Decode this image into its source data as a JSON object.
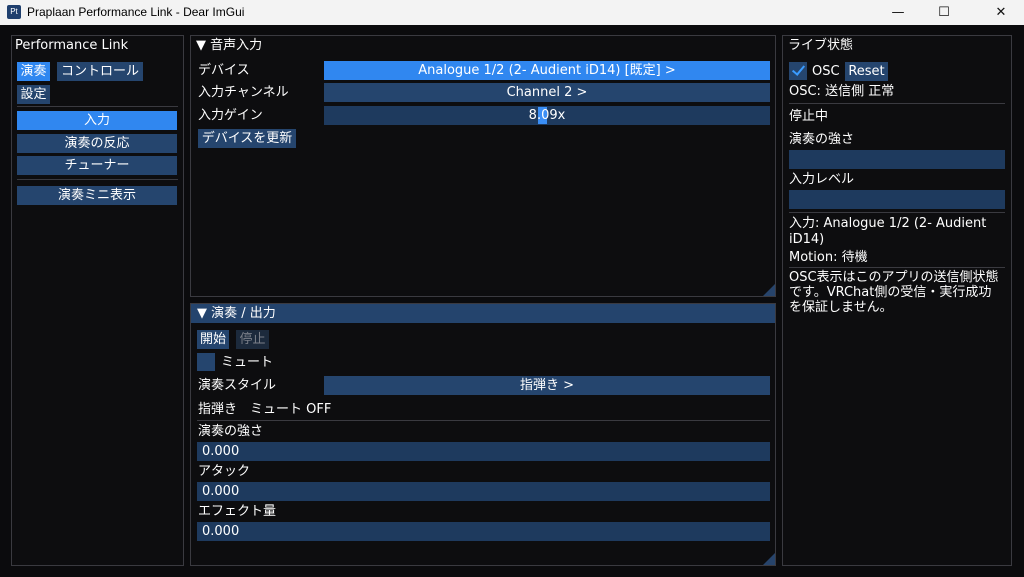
{
  "window": {
    "title": "Praplaan Performance Link - Dear ImGui",
    "icon_text": "Pt",
    "minimize": "—",
    "maximize": "☐",
    "close": "✕"
  },
  "left": {
    "title": "Performance Link",
    "tab_play": "演奏",
    "tab_control": "コントロール",
    "tab_settings": "設定",
    "nav_input": "入力",
    "nav_reaction": "演奏の反応",
    "nav_tuner": "チューナー",
    "mini_view": "演奏ミニ表示"
  },
  "audio": {
    "header": "▼ 音声入力",
    "device_label": "デバイス",
    "device_value": "Analogue 1/2 (2- Audient iD14) [既定] >",
    "channel_label": "入力チャンネル",
    "channel_value": "Channel 2 >",
    "gain_label": "入力ゲイン",
    "gain_value": "8.09x",
    "gain_fraction": 0.49,
    "refresh": "デバイスを更新"
  },
  "play": {
    "header": "▼ 演奏 / 出力",
    "start": "開始",
    "stop": "停止",
    "mute_label": "ミュート",
    "style_label": "演奏スタイル",
    "style_value": "指弾き >",
    "status_line": "指弾き　ミュート OFF",
    "strength_label": "演奏の強さ",
    "strength_value": "0.000",
    "attack_label": "アタック",
    "attack_value": "0.000",
    "effect_label": "エフェクト量",
    "effect_value": "0.000"
  },
  "live": {
    "title": "ライブ状態",
    "osc_label": "OSC",
    "reset": "Reset",
    "osc_status": "OSC: 送信側 正常",
    "stopped": "停止中",
    "strength_label": "演奏の強さ",
    "level_label": "入力レベル",
    "input_info": "入力: Analogue 1/2 (2- Audient iD14)",
    "motion": "Motion: 待機",
    "note": "OSC表示はこのアプリの送信側状態です。VRChat側の受信・実行成功を保証しません。"
  }
}
